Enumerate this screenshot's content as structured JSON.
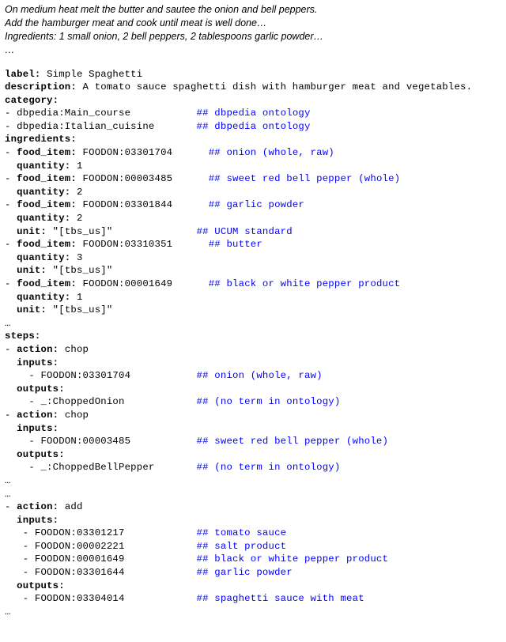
{
  "intro": {
    "line1": "On medium heat melt the butter and sautee the onion and bell peppers.",
    "line2": "Add the hamburger meat and cook until meat is well done…",
    "line3": "Ingredients: 1 small onion, 2 bell peppers, 2 tablespoons garlic powder…",
    "line4": "…"
  },
  "yaml": {
    "k_label": "label:",
    "v_label": " Simple Spaghetti",
    "k_desc": "description:",
    "v_desc": " A tomato sauce spaghetti dish with hamburger meat and vegetables.",
    "k_cat": "category:",
    "cat1": "- dbpedia:Main_course           ",
    "cat1_c": "## dbpedia ontology",
    "cat2": "- dbpedia:Italian_cuisine       ",
    "cat2_c": "## dbpedia ontology",
    "k_ing": "ingredients:",
    "i1_k": "- ",
    "i1_f": "food_item:",
    "i1_v": " FOODON:03301704      ",
    "i1_c": "## onion (whole, raw)",
    "i1_qk": "quantity:",
    "i1_qv": " 1",
    "i2_k": "- ",
    "i2_f": "food_item:",
    "i2_v": " FOODON:00003485      ",
    "i2_c": "## sweet red bell pepper (whole)",
    "i2_qk": "quantity:",
    "i2_qv": " 2",
    "i3_k": "- ",
    "i3_f": "food_item:",
    "i3_v": " FOODON:03301844      ",
    "i3_c": "## garlic powder",
    "i3_qk": "quantity:",
    "i3_qv": " 2",
    "i3_uk": "unit:",
    "i3_uv": " \"[tbs_us]\"              ",
    "i3_uc": "## UCUM standard",
    "i4_k": "- ",
    "i4_f": "food_item:",
    "i4_v": " FOODON:03310351      ",
    "i4_c": "## butter",
    "i4_qk": "quantity:",
    "i4_qv": " 3",
    "i4_uk": "unit:",
    "i4_uv": " \"[tbs_us]\"",
    "i5_k": "- ",
    "i5_f": "food_item:",
    "i5_v": " FOODON:00001649      ",
    "i5_c": "## black or white pepper product",
    "i5_qk": "quantity:",
    "i5_qv": " 1",
    "i5_uk": "unit:",
    "i5_uv": " \"[tbs_us]\"",
    "ell1": "…",
    "k_steps": "steps:",
    "s1_a": "- ",
    "s1_ak": "action:",
    "s1_av": " chop",
    "s1_ik": "inputs:",
    "s1_i1": "    - FOODON:03301704           ",
    "s1_i1c": "## onion (whole, raw)",
    "s1_ok": "outputs:",
    "s1_o1": "    - _:ChoppedOnion            ",
    "s1_o1c": "## (no term in ontology)",
    "s2_a": "- ",
    "s2_ak": "action:",
    "s2_av": " chop",
    "s2_ik": "inputs:",
    "s2_i1": "    - FOODON:00003485           ",
    "s2_i1c": "## sweet red bell pepper (whole)",
    "s2_ok": "outputs:",
    "s2_o1": "    - _:ChoppedBellPepper       ",
    "s2_o1c": "## (no term in ontology)",
    "ell2": "…",
    "ell3": "…",
    "s3_a": "- ",
    "s3_ak": "action:",
    "s3_av": " add",
    "s3_ik": "inputs:",
    "s3_i1": "   - FOODON:03301217            ",
    "s3_i1c": "## tomato sauce",
    "s3_i2": "   - FOODON:00002221            ",
    "s3_i2c": "## salt product",
    "s3_i3": "   - FOODON:00001649            ",
    "s3_i3c": "## black or white pepper product",
    "s3_i4": "   - FOODON:03301644            ",
    "s3_i4c": "## garlic powder",
    "s3_ok": "outputs:",
    "s3_o1": "   - FOODON:03304014            ",
    "s3_o1c": "## spaghetti sauce with meat",
    "ell4": "…"
  }
}
